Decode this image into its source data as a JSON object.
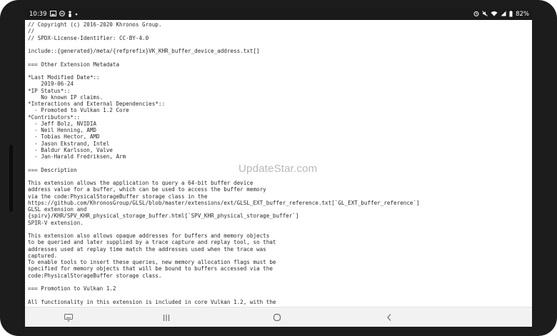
{
  "status_bar": {
    "time": "10:39",
    "battery": "82%",
    "left_icons": [
      "gallery-icon",
      "minus-circle-icon",
      "person-icon",
      "dot-icon"
    ],
    "right_icons": [
      "alarm-icon",
      "mute-icon",
      "wifi-icon",
      "signal-icon",
      "battery-icon"
    ]
  },
  "document": {
    "lines": [
      "// Copyright (c) 2016-2020 Khronos Group.",
      "//",
      "// SPDX-License-Identifier: CC-BY-4.0",
      "",
      "include::{generated}/meta/{refprefix}VK_KHR_buffer_device_address.txt[]",
      "",
      "=== Other Extension Metadata",
      "",
      "*Last Modified Date*::",
      "    2019-06-24",
      "*IP Status*::",
      "    No known IP claims.",
      "*Interactions and External Dependencies*::",
      "  - Promoted to Vulkan 1.2 Core",
      "*Contributors*::",
      "  - Jeff Bolz, NVIDIA",
      "  - Neil Henning, AMD",
      "  - Tobias Hector, AMD",
      "  - Jason Ekstrand, Intel",
      "  - Baldur Karlsson, Valve",
      "  - Jan-Harald Fredriksen, Arm",
      "",
      "=== Description",
      "",
      "This extension allows the application to query a 64-bit buffer device",
      "address value for a buffer, which can be used to access the buffer memory",
      "via the code:PhysicalStorageBuffer storage class in the",
      "https://github.com/KhronosGroup/GLSL/blob/master/extensions/ext/GLSL_EXT_buffer_reference.txt[`GL_EXT_buffer_reference`]",
      "GLSL extension and",
      "{spirv}/KHR/SPV_KHR_physical_storage_buffer.html[`SPV_KHR_physical_storage_buffer`]",
      "SPIR-V extension.",
      "",
      "This extension also allows opaque addresses for buffers and memory objects",
      "to be queried and later supplied by a trace capture and replay tool, so that",
      "addresses used at replay time match the addresses used when the trace was",
      "captured.",
      "To enable tools to insert these queries, new memory allocation flags must be",
      "specified for memory objects that will be bound to buffers accessed via the",
      "code:PhysicalStorageBuffer storage class.",
      "",
      "=== Promotion to Vulkan 1.2",
      "",
      "All functionality in this extension is included in core Vulkan 1.2, with the"
    ]
  },
  "watermark": "UpdateStar.com",
  "nav_bar": {
    "icons": [
      "keyboard-icon",
      "recents-icon",
      "home-icon",
      "back-icon"
    ]
  }
}
